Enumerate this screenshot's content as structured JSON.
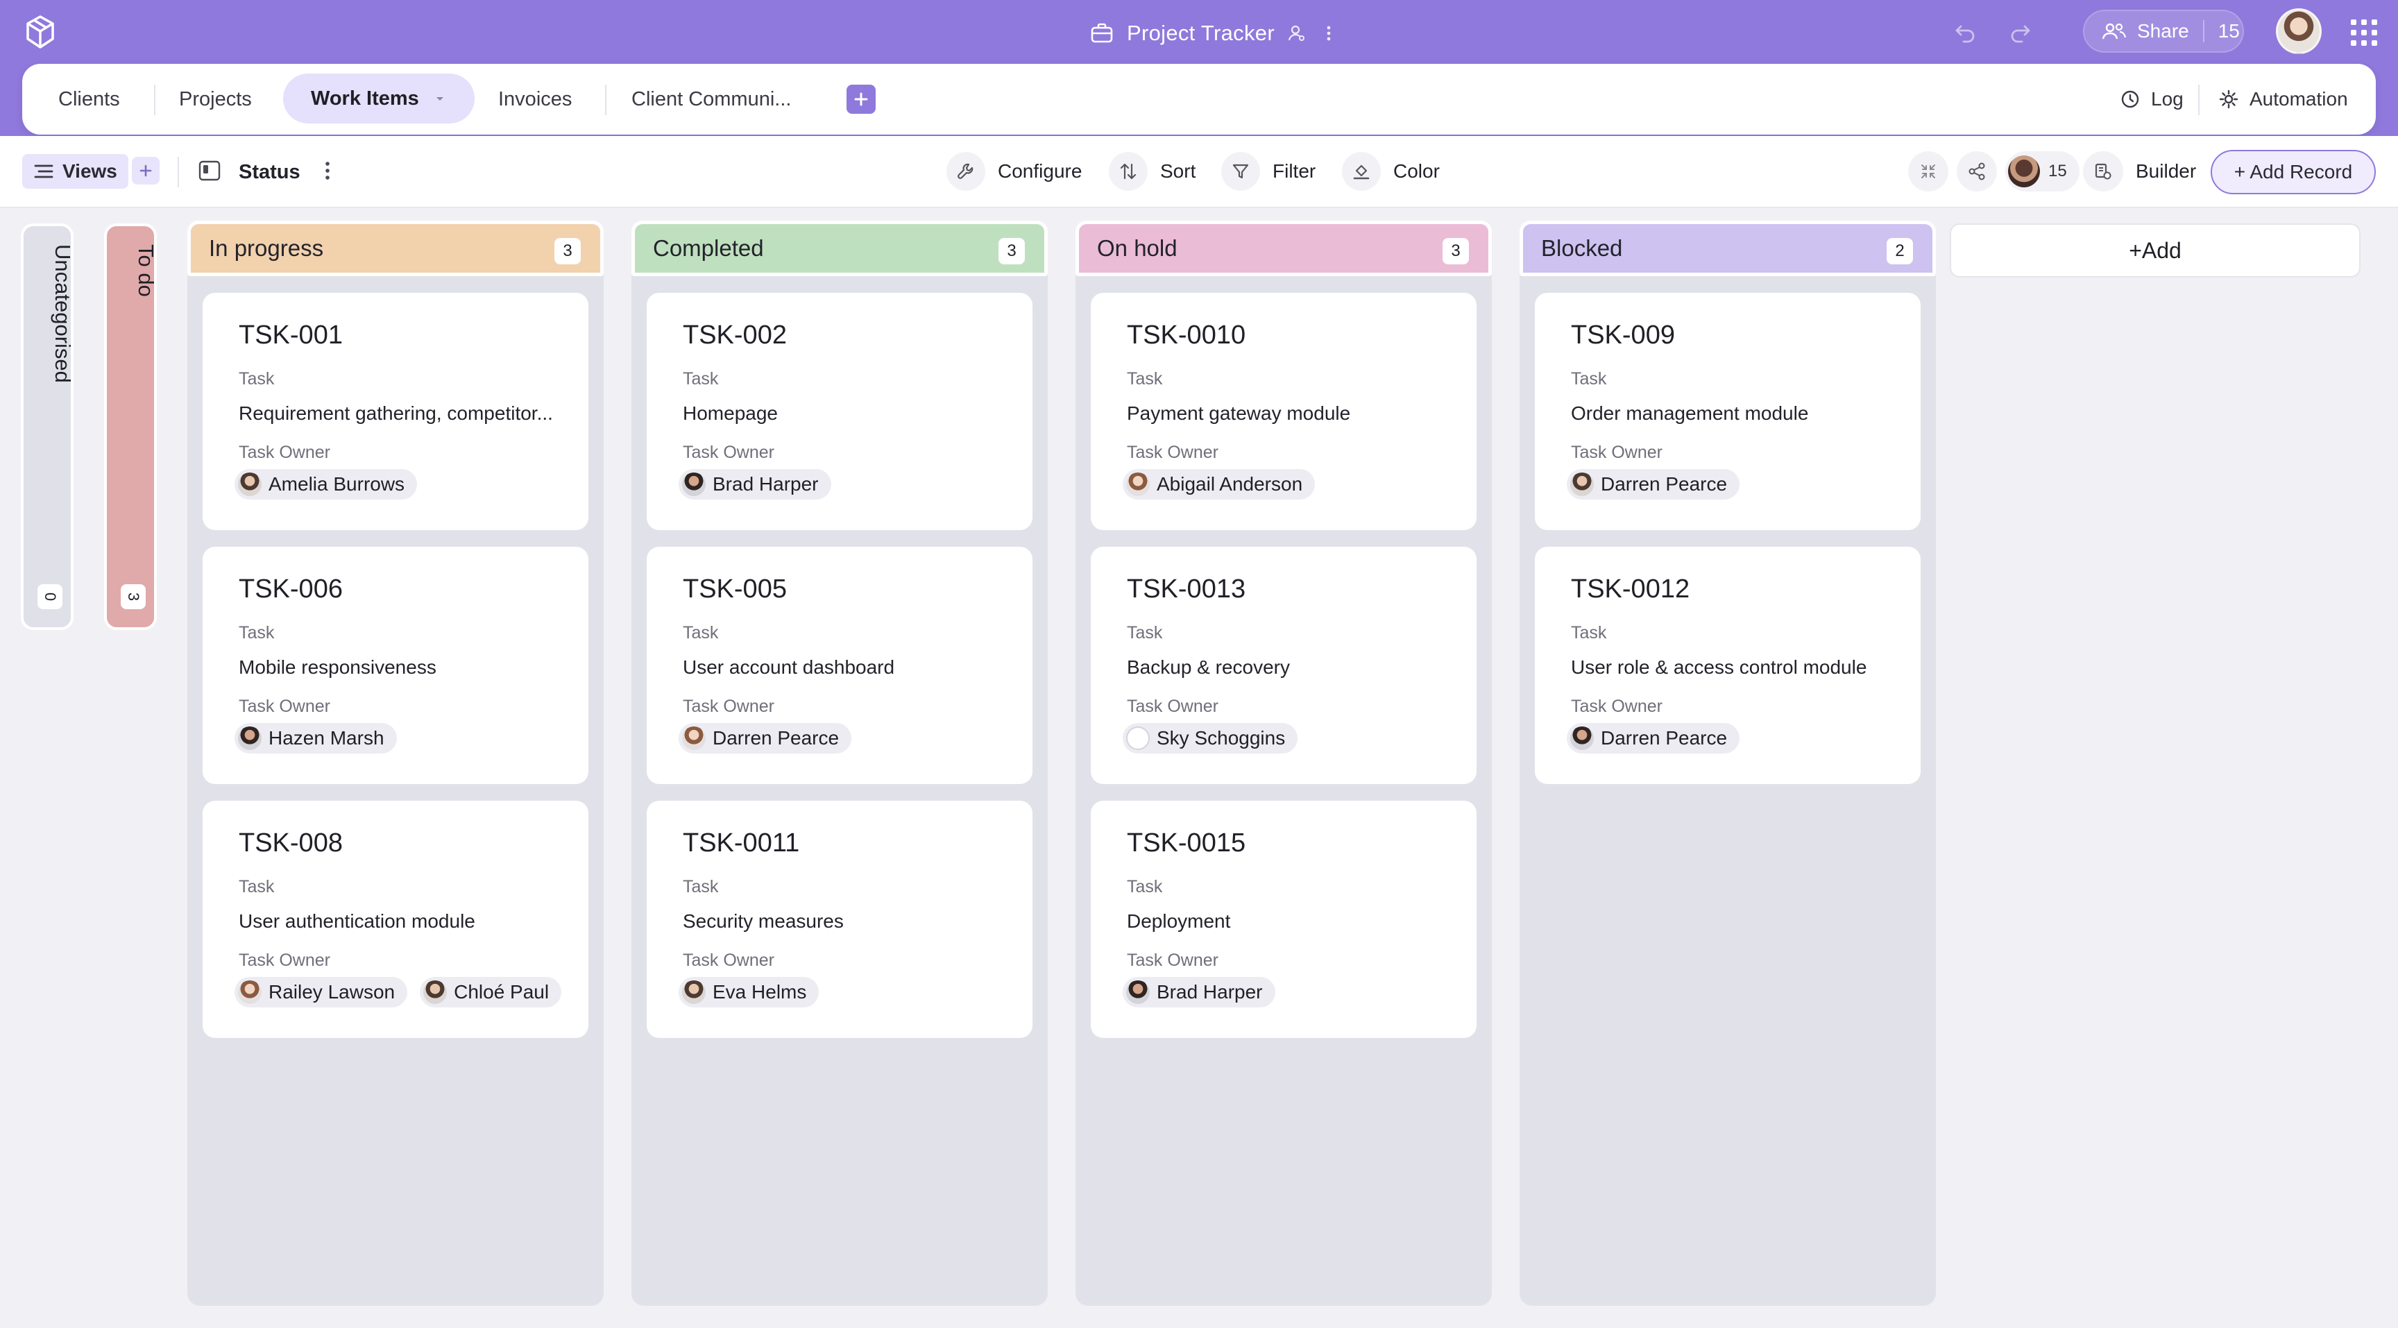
{
  "app": {
    "title": "Project Tracker",
    "share_label": "Share",
    "share_count": "15"
  },
  "tabs": [
    {
      "label": "Clients"
    },
    {
      "label": "Projects"
    },
    {
      "label": "Work Items",
      "active": true
    },
    {
      "label": "Invoices"
    },
    {
      "label": "Client Communi..."
    }
  ],
  "tab_actions": {
    "log": "Log",
    "automation": "Automation"
  },
  "toolbar": {
    "views": "Views",
    "group_by": "Status",
    "configure": "Configure",
    "sort": "Sort",
    "filter": "Filter",
    "color": "Color",
    "collaborators": "15",
    "builder": "Builder",
    "add_record": "+ Add Record"
  },
  "collapsed_columns": [
    {
      "label": "Uncategorised",
      "count": "0",
      "color": "#dfe0e8"
    },
    {
      "label": "To do",
      "count": "3",
      "color": "#e0a9aa"
    }
  ],
  "columns": [
    {
      "label": "In progress",
      "count": "3",
      "color": "#f2d1ad",
      "cards": [
        {
          "id": "TSK-001",
          "type": "Task",
          "name": "Requirement gathering, competitor...",
          "owner_label": "Task Owner",
          "owners": [
            "Amelia Burrows"
          ]
        },
        {
          "id": "TSK-006",
          "type": "Task",
          "name": "Mobile responsiveness",
          "owner_label": "Task Owner",
          "owners": [
            "Hazen Marsh"
          ]
        },
        {
          "id": "TSK-008",
          "type": "Task",
          "name": "User authentication module",
          "owner_label": "Task Owner",
          "owners": [
            "Railey Lawson",
            "Chloé Paul"
          ]
        }
      ]
    },
    {
      "label": "Completed",
      "count": "3",
      "color": "#bfe0bf",
      "cards": [
        {
          "id": "TSK-002",
          "type": "Task",
          "name": "Homepage",
          "owner_label": "Task Owner",
          "owners": [
            "Brad Harper"
          ]
        },
        {
          "id": "TSK-005",
          "type": "Task",
          "name": "User account dashboard",
          "owner_label": "Task Owner",
          "owners": [
            "Darren Pearce"
          ]
        },
        {
          "id": "TSK-0011",
          "type": "Task",
          "name": "Security measures",
          "owner_label": "Task Owner",
          "owners": [
            "Eva Helms"
          ]
        }
      ]
    },
    {
      "label": "On hold",
      "count": "3",
      "color": "#ebbcd6",
      "cards": [
        {
          "id": "TSK-0010",
          "type": "Task",
          "name": "Payment gateway module",
          "owner_label": "Task Owner",
          "owners": [
            "Abigail Anderson"
          ]
        },
        {
          "id": "TSK-0013",
          "type": "Task",
          "name": "Backup & recovery",
          "owner_label": "Task Owner",
          "owners": [
            "Sky Schoggins"
          ]
        },
        {
          "id": "TSK-0015",
          "type": "Task",
          "name": "Deployment",
          "owner_label": "Task Owner",
          "owners": [
            "Brad Harper"
          ]
        }
      ]
    },
    {
      "label": "Blocked",
      "count": "2",
      "color": "#cdc2f0",
      "cards": [
        {
          "id": "TSK-009",
          "type": "Task",
          "name": "Order management module",
          "owner_label": "Task Owner",
          "owners": [
            "Darren Pearce"
          ]
        },
        {
          "id": "TSK-0012",
          "type": "Task",
          "name": "User role & access control module",
          "owner_label": "Task Owner",
          "owners": [
            "Darren Pearce"
          ]
        }
      ]
    }
  ],
  "add_column_label": "+Add"
}
